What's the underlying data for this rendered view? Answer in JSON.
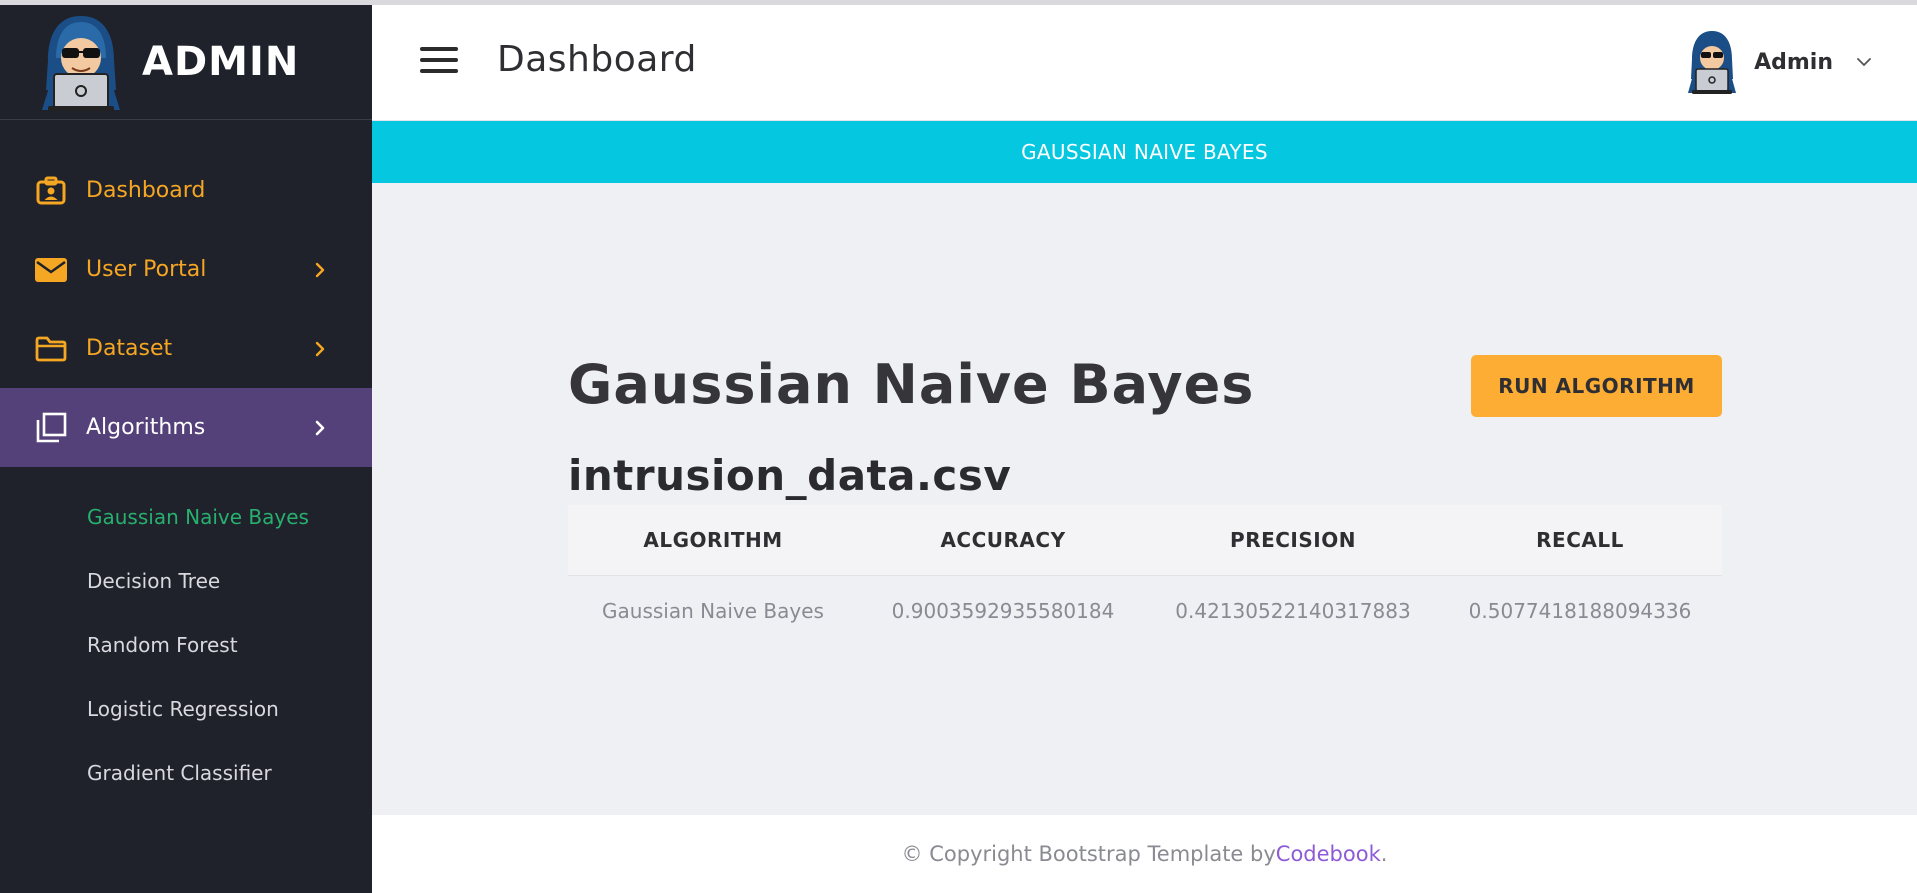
{
  "app": {
    "brand": "ADMIN"
  },
  "header": {
    "title": "Dashboard",
    "user_name": "Admin"
  },
  "sidebar": {
    "items": [
      {
        "label": "Dashboard"
      },
      {
        "label": "User Portal"
      },
      {
        "label": "Dataset"
      },
      {
        "label": "Algorithms"
      }
    ],
    "subitems": [
      {
        "label": "Gaussian Naive Bayes"
      },
      {
        "label": "Decision Tree"
      },
      {
        "label": "Random Forest"
      },
      {
        "label": "Logistic Regression"
      },
      {
        "label": "Gradient Classifier"
      }
    ]
  },
  "banner": {
    "text": "GAUSSIAN NAIVE BAYES"
  },
  "main": {
    "algo_title": "Gaussian Naive Bayes",
    "run_button": "RUN ALGORITHM",
    "file_name": "intrusion_data.csv",
    "table": {
      "headers": [
        "ALGORITHM",
        "ACCURACY",
        "PRECISION",
        "RECALL"
      ],
      "rows": [
        [
          "Gaussian Naive Bayes",
          "0.9003592935580184",
          "0.42130522140317883",
          "0.5077418188094336"
        ]
      ]
    }
  },
  "footer": {
    "prefix": "© Copyright Bootstrap Template by ",
    "link": "Codebook",
    "suffix": "."
  },
  "colors": {
    "sidebar_bg": "#1f222b",
    "accent_orange": "#f5a623",
    "active_purple": "#55417a",
    "banner_cyan": "#06c7e0",
    "button_orange": "#fdad34",
    "current_green": "#27b06e",
    "link_purple": "#8e5bd6"
  },
  "icons": {
    "dashboard": "id-badge-icon",
    "user_portal": "envelope-icon",
    "dataset": "folder-icon",
    "algorithms": "copy-icon",
    "chevron": "chevron-right-icon",
    "menu": "hamburger-icon",
    "user": "hacker-avatar",
    "user_dropdown": "chevron-down-icon"
  }
}
